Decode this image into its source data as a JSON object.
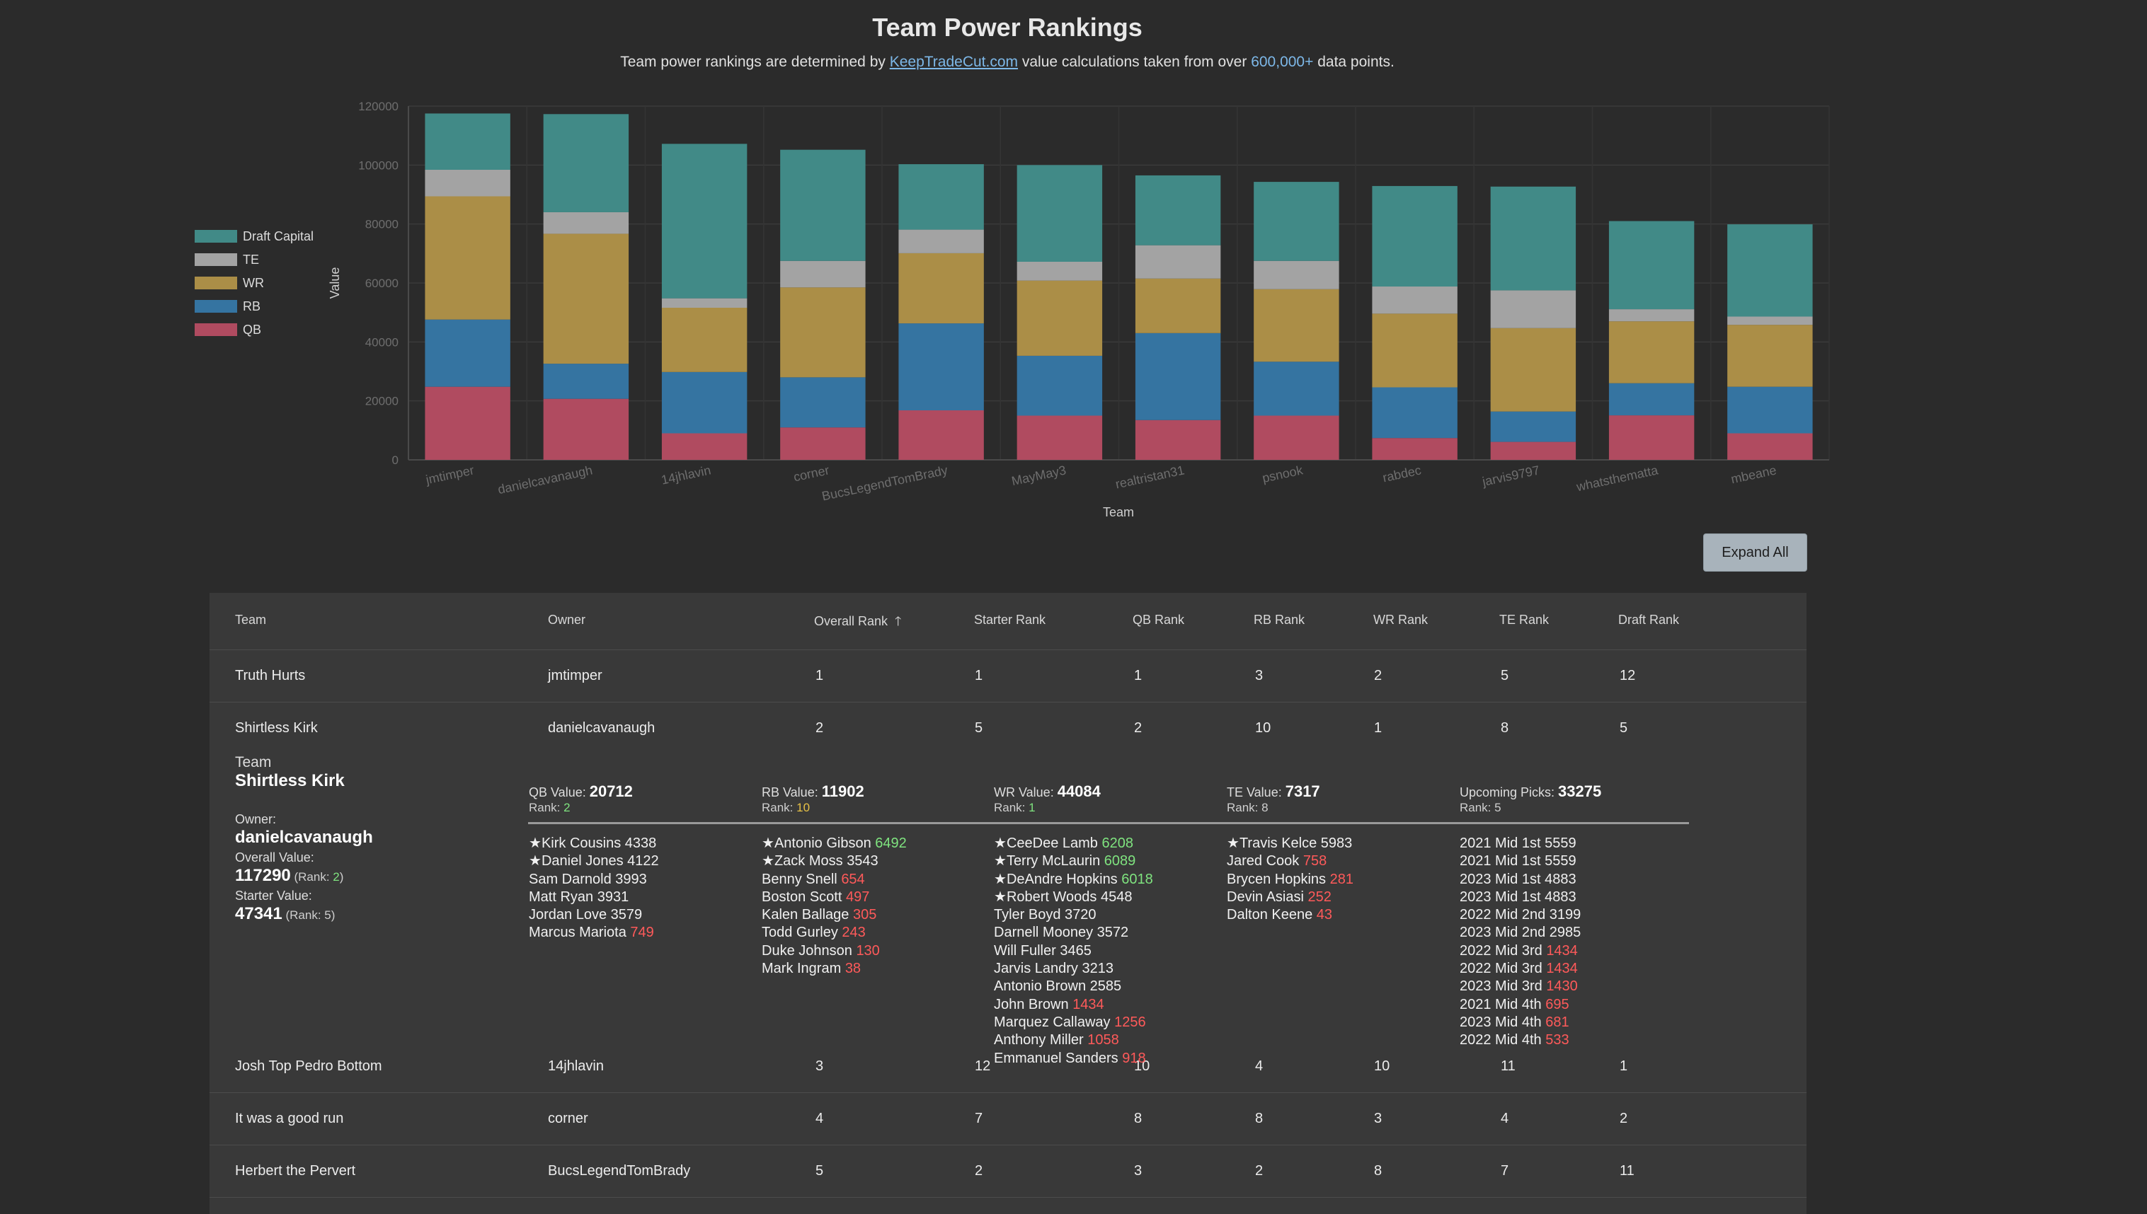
{
  "header": {
    "title": "Team Power Rankings",
    "subtitle_pre": "Team power rankings are determined by ",
    "subtitle_link": "KeepTradeCut.com",
    "subtitle_mid": " value calculations taken from over ",
    "subtitle_highlight": "600,000+",
    "subtitle_post": " data points."
  },
  "chart_data": {
    "type": "bar",
    "stacked": true,
    "categories": [
      "jmtimper",
      "danielcavanaugh",
      "14jhlavin",
      "corner",
      "BucsLegendTomBrady",
      "MayMay3",
      "realtristan31",
      "psnook",
      "rabdec",
      "jarvis9797",
      "whatsthematta",
      "mbeane"
    ],
    "series": [
      {
        "name": "QB",
        "color": "#b04b60",
        "values": [
          24800,
          20712,
          9000,
          11000,
          16800,
          15000,
          13500,
          15000,
          7400,
          6100,
          15100,
          9000
        ]
      },
      {
        "name": "RB",
        "color": "#3574a1",
        "values": [
          22800,
          11902,
          20800,
          17000,
          29500,
          20300,
          29500,
          18300,
          17200,
          10300,
          10900,
          15800
        ]
      },
      {
        "name": "WR",
        "color": "#ab8e47",
        "values": [
          41800,
          44084,
          21800,
          30500,
          23800,
          25500,
          18500,
          24600,
          25000,
          28300,
          21000,
          21000
        ]
      },
      {
        "name": "TE",
        "color": "#a3a3a3",
        "values": [
          9000,
          7317,
          3200,
          9000,
          8000,
          6400,
          11300,
          9600,
          9200,
          12800,
          4100,
          2800
        ]
      },
      {
        "name": "Draft Capital",
        "color": "#418a87",
        "values": [
          19100,
          33275,
          52400,
          37700,
          22200,
          32800,
          23700,
          26800,
          34100,
          35200,
          29900,
          31300
        ]
      }
    ],
    "xlabel": "Team",
    "ylabel": "Value",
    "ylim": [
      0,
      120000
    ],
    "yticks": [
      "0",
      "20000",
      "40000",
      "60000",
      "80000",
      "100000",
      "120000"
    ],
    "grid": true,
    "legend": "left"
  },
  "controls": {
    "expand_all": "Expand All"
  },
  "table": {
    "headers": [
      "Team",
      "Owner",
      "Overall Rank",
      "Starter Rank",
      "QB Rank",
      "RB Rank",
      "WR Rank",
      "TE Rank",
      "Draft Rank"
    ],
    "rows": [
      [
        "Truth Hurts",
        "jmtimper",
        "1",
        "1",
        "1",
        "3",
        "2",
        "5",
        "12"
      ],
      [
        "Shirtless Kirk",
        "danielcavanaugh",
        "2",
        "5",
        "2",
        "10",
        "1",
        "8",
        "5"
      ],
      [
        "Josh Top Pedro Bottom",
        "14jhlavin",
        "3",
        "12",
        "10",
        "4",
        "10",
        "11",
        "1"
      ],
      [
        "It was a good run",
        "corner",
        "4",
        "7",
        "8",
        "8",
        "3",
        "4",
        "2"
      ],
      [
        "Herbert the Pervert",
        "BucsLegendTomBrady",
        "5",
        "2",
        "3",
        "2",
        "8",
        "7",
        "11"
      ]
    ]
  },
  "detail": {
    "team_label": "Team",
    "team_name": "Shirtless Kirk",
    "owner_label": "Owner:",
    "owner": "danielcavanaugh",
    "overall_label": "Overall Value:",
    "overall_value": "117290",
    "overall_rank_pre": " (Rank: ",
    "overall_rank": "2",
    "overall_rank_post": ")",
    "starter_label": "Starter Value:",
    "starter_value": "47341",
    "starter_rank_text": " (Rank: 5)",
    "groups": [
      {
        "label": "QB Value: ",
        "value": "20712",
        "rank_label": "Rank: ",
        "rank": "2",
        "rank_class": "g",
        "players": [
          {
            "star": true,
            "name": "Kirk Cousins",
            "value": "4338",
            "cls": ""
          },
          {
            "star": true,
            "name": "Daniel Jones",
            "value": "4122",
            "cls": ""
          },
          {
            "star": false,
            "name": "Sam Darnold",
            "value": "3993",
            "cls": ""
          },
          {
            "star": false,
            "name": "Matt Ryan",
            "value": "3931",
            "cls": ""
          },
          {
            "star": false,
            "name": "Jordan Love",
            "value": "3579",
            "cls": ""
          },
          {
            "star": false,
            "name": "Marcus Mariota",
            "value": "749",
            "cls": "r"
          }
        ]
      },
      {
        "label": "RB Value: ",
        "value": "11902",
        "rank_label": "Rank: ",
        "rank": "10",
        "rank_class": "y",
        "players": [
          {
            "star": true,
            "name": "Antonio Gibson",
            "value": "6492",
            "cls": "g"
          },
          {
            "star": true,
            "name": "Zack Moss",
            "value": "3543",
            "cls": ""
          },
          {
            "star": false,
            "name": "Benny Snell",
            "value": "654",
            "cls": "r"
          },
          {
            "star": false,
            "name": "Boston Scott",
            "value": "497",
            "cls": "r"
          },
          {
            "star": false,
            "name": "Kalen Ballage",
            "value": "305",
            "cls": "r"
          },
          {
            "star": false,
            "name": "Todd Gurley",
            "value": "243",
            "cls": "r"
          },
          {
            "star": false,
            "name": "Duke Johnson",
            "value": "130",
            "cls": "r"
          },
          {
            "star": false,
            "name": "Mark Ingram",
            "value": "38",
            "cls": "r"
          }
        ]
      },
      {
        "label": "WR Value: ",
        "value": "44084",
        "rank_label": "Rank: ",
        "rank": "1",
        "rank_class": "g",
        "players": [
          {
            "star": true,
            "name": "CeeDee Lamb",
            "value": "6208",
            "cls": "g"
          },
          {
            "star": true,
            "name": "Terry McLaurin",
            "value": "6089",
            "cls": "g"
          },
          {
            "star": true,
            "name": "DeAndre Hopkins",
            "value": "6018",
            "cls": "g"
          },
          {
            "star": true,
            "name": "Robert Woods",
            "value": "4548",
            "cls": ""
          },
          {
            "star": false,
            "name": "Tyler Boyd",
            "value": "3720",
            "cls": ""
          },
          {
            "star": false,
            "name": "Darnell Mooney",
            "value": "3572",
            "cls": ""
          },
          {
            "star": false,
            "name": "Will Fuller",
            "value": "3465",
            "cls": ""
          },
          {
            "star": false,
            "name": "Jarvis Landry",
            "value": "3213",
            "cls": ""
          },
          {
            "star": false,
            "name": "Antonio Brown",
            "value": "2585",
            "cls": ""
          },
          {
            "star": false,
            "name": "John Brown",
            "value": "1434",
            "cls": "r"
          },
          {
            "star": false,
            "name": "Marquez Callaway",
            "value": "1256",
            "cls": "r"
          },
          {
            "star": false,
            "name": "Anthony Miller",
            "value": "1058",
            "cls": "r"
          },
          {
            "star": false,
            "name": "Emmanuel Sanders",
            "value": "918",
            "cls": "r"
          }
        ]
      },
      {
        "label": "TE Value: ",
        "value": "7317",
        "rank_label": "Rank: ",
        "rank": "8",
        "rank_class": "",
        "players": [
          {
            "star": true,
            "name": "Travis Kelce",
            "value": "5983",
            "cls": ""
          },
          {
            "star": false,
            "name": "Jared Cook",
            "value": "758",
            "cls": "r"
          },
          {
            "star": false,
            "name": "Brycen Hopkins",
            "value": "281",
            "cls": "r"
          },
          {
            "star": false,
            "name": "Devin Asiasi",
            "value": "252",
            "cls": "r"
          },
          {
            "star": false,
            "name": "Dalton Keene",
            "value": "43",
            "cls": "r"
          }
        ]
      },
      {
        "label": "Upcoming Picks: ",
        "value": "33275",
        "rank_label": "Rank: ",
        "rank": "5",
        "rank_class": "",
        "players": [
          {
            "star": false,
            "name": "2021 Mid 1st",
            "value": "5559",
            "cls": ""
          },
          {
            "star": false,
            "name": "2021 Mid 1st",
            "value": "5559",
            "cls": ""
          },
          {
            "star": false,
            "name": "2023 Mid 1st",
            "value": "4883",
            "cls": ""
          },
          {
            "star": false,
            "name": "2023 Mid 1st",
            "value": "4883",
            "cls": ""
          },
          {
            "star": false,
            "name": "2022 Mid 2nd",
            "value": "3199",
            "cls": ""
          },
          {
            "star": false,
            "name": "2023 Mid 2nd",
            "value": "2985",
            "cls": ""
          },
          {
            "star": false,
            "name": "2022 Mid 3rd",
            "value": "1434",
            "cls": "r"
          },
          {
            "star": false,
            "name": "2022 Mid 3rd",
            "value": "1434",
            "cls": "r"
          },
          {
            "star": false,
            "name": "2023 Mid 3rd",
            "value": "1430",
            "cls": "r"
          },
          {
            "star": false,
            "name": "2021 Mid 4th",
            "value": "695",
            "cls": "r"
          },
          {
            "star": false,
            "name": "2023 Mid 4th",
            "value": "681",
            "cls": "r"
          },
          {
            "star": false,
            "name": "2022 Mid 4th",
            "value": "533",
            "cls": "r"
          }
        ]
      }
    ]
  }
}
